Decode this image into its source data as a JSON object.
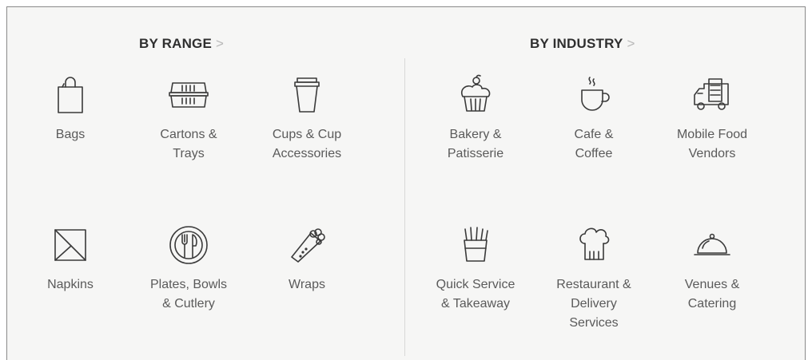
{
  "range": {
    "heading": "BY RANGE",
    "chevron": ">",
    "items": [
      {
        "label": "Bags",
        "icon": "bag-icon"
      },
      {
        "label": "Cartons &\nTrays",
        "icon": "carton-tray-icon"
      },
      {
        "label": "Cups & Cup\nAccessories",
        "icon": "cup-icon"
      },
      {
        "label": "Napkins",
        "icon": "napkin-icon"
      },
      {
        "label": "Plates, Bowls\n& Cutlery",
        "icon": "plate-cutlery-icon"
      },
      {
        "label": "Wraps",
        "icon": "wrap-icon"
      }
    ]
  },
  "industry": {
    "heading": "BY INDUSTRY",
    "chevron": ">",
    "items": [
      {
        "label": "Bakery &\nPatisserie",
        "icon": "cupcake-icon"
      },
      {
        "label": "Cafe &\nCoffee",
        "icon": "coffee-cup-icon"
      },
      {
        "label": "Mobile Food\nVendors",
        "icon": "food-truck-icon"
      },
      {
        "label": "Quick Service\n& Takeaway",
        "icon": "fries-icon"
      },
      {
        "label": "Restaurant &\nDelivery\nServices",
        "icon": "chef-hat-icon"
      },
      {
        "label": "Venues &\nCatering",
        "icon": "cloche-icon"
      }
    ]
  },
  "colors": {
    "panel_bg": "#f6f6f5",
    "heading": "#2f2f2f",
    "label": "#5a5a5a",
    "icon_stroke": "#3a3a3a"
  }
}
